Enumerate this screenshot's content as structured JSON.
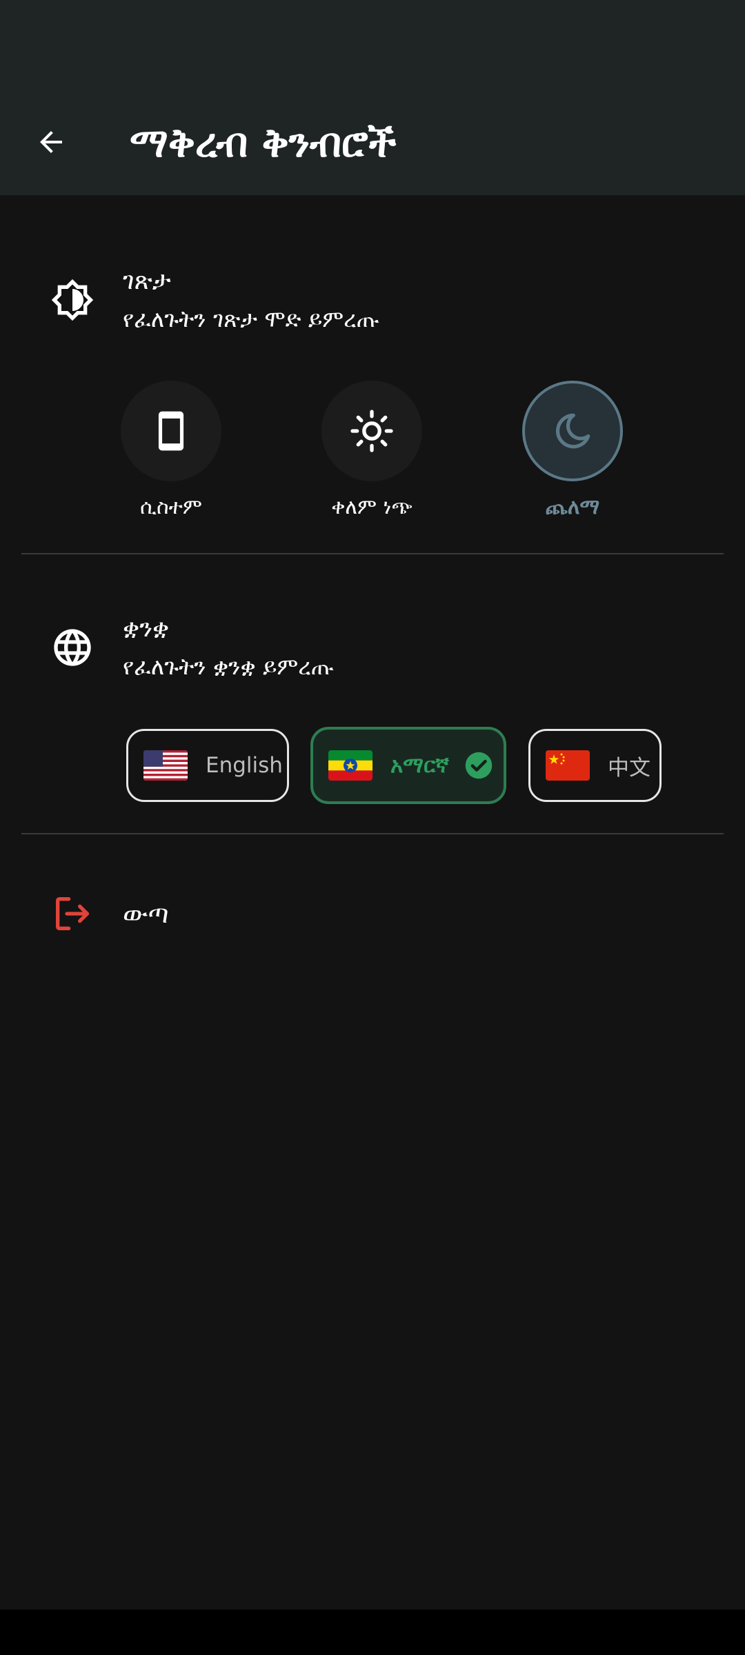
{
  "header": {
    "title": "ማቅረብ ቅንብሮች"
  },
  "theme_section": {
    "title": "ገጽታ",
    "subtitle": "የፈለጉትን ገጽታ ሞድ ይምረጡ",
    "options": [
      {
        "label": "ሲስተም",
        "icon": "phone-icon",
        "selected": false
      },
      {
        "label": "ቀለም ነጭ",
        "icon": "sun-icon",
        "selected": false
      },
      {
        "label": "ጨለማ",
        "icon": "moon-icon",
        "selected": true
      }
    ]
  },
  "language_section": {
    "title": "ቋንቋ",
    "subtitle": "የፈለጉትን ቋንቋ ይምረጡ",
    "options": [
      {
        "label": "English",
        "flag": "us-flag-icon",
        "selected": false
      },
      {
        "label": "አማርኛ",
        "flag": "ethiopia-flag-icon",
        "selected": true
      },
      {
        "label": "中文",
        "flag": "china-flag-icon",
        "selected": false
      }
    ]
  },
  "logout": {
    "label": "ውጣ"
  },
  "colors": {
    "background": "#131313",
    "appbar": "#1f2424",
    "selected_theme": "#5b7886",
    "selected_language": "#2e7d50",
    "logout_icon": "#e0443a"
  }
}
